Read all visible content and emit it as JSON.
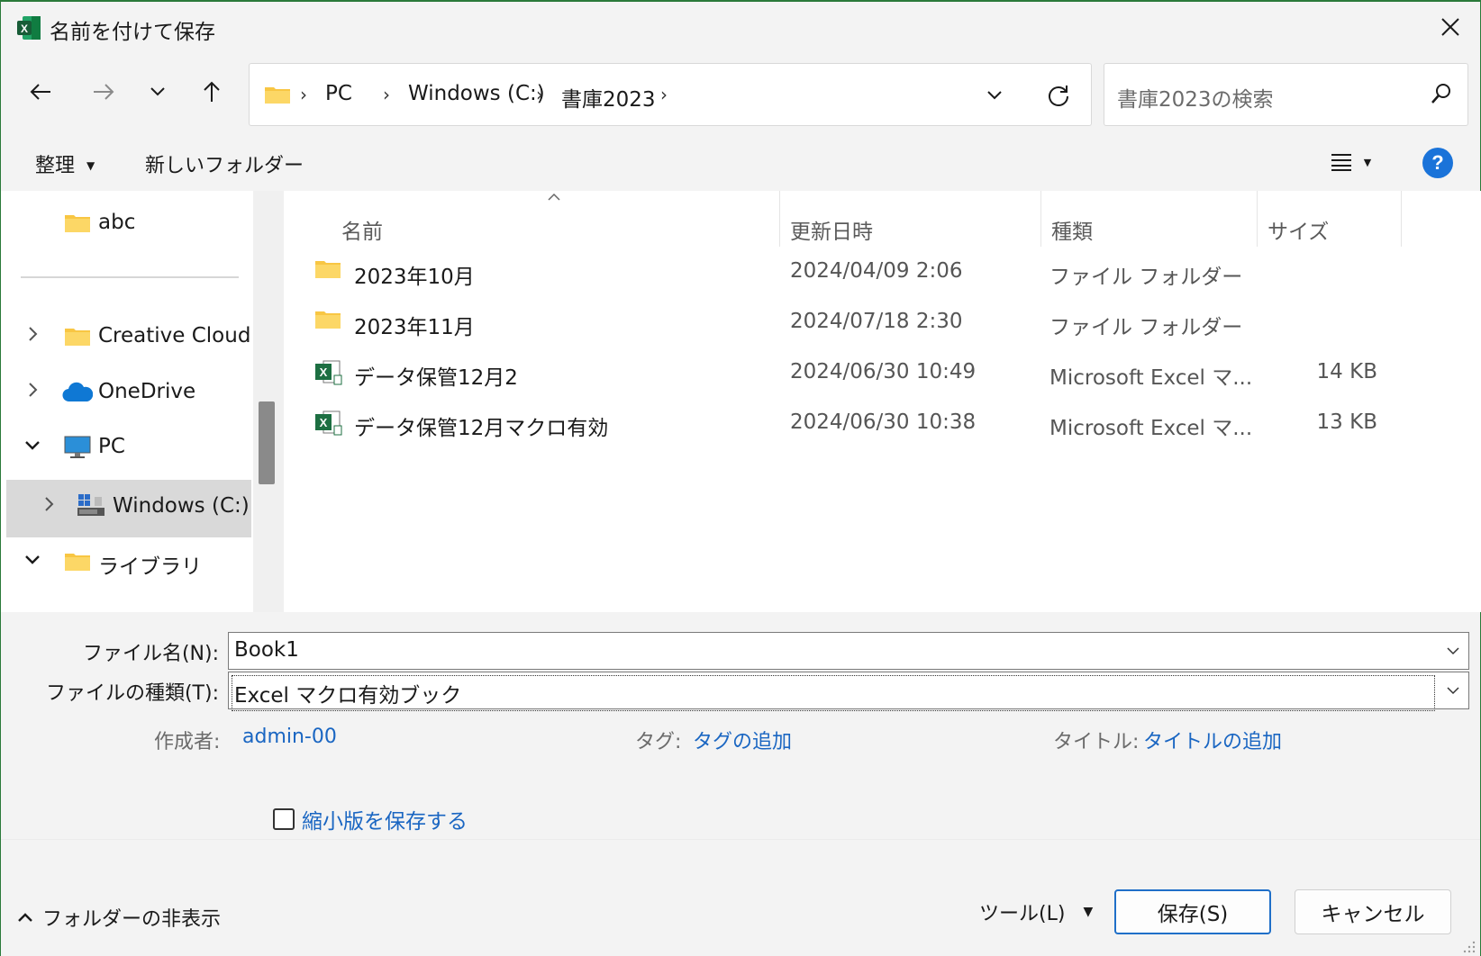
{
  "window": {
    "title": "名前を付けて保存",
    "app_icon": "excel-icon"
  },
  "nav": {
    "breadcrumbs": [
      "PC",
      "Windows (C:)",
      "書庫2023"
    ],
    "search_placeholder": "書庫2023の検索"
  },
  "toolbar": {
    "organize": "整理",
    "new_folder": "新しいフォルダー"
  },
  "sidebar": {
    "items": [
      {
        "label": "abc",
        "icon": "folder-icon"
      },
      {
        "label": "Creative Cloud F",
        "icon": "folder-icon"
      },
      {
        "label": "OneDrive",
        "icon": "cloud-icon"
      },
      {
        "label": "PC",
        "icon": "monitor-icon"
      },
      {
        "label": "Windows (C:)",
        "icon": "drive-icon"
      },
      {
        "label": "ライブラリ",
        "icon": "folder-icon"
      }
    ]
  },
  "columns": {
    "name": "名前",
    "modified": "更新日時",
    "type": "種類",
    "size": "サイズ"
  },
  "files": [
    {
      "name": "2023年10月",
      "modified": "2024/04/09 2:06",
      "type": "ファイル フォルダー",
      "size": "",
      "icon": "folder-icon"
    },
    {
      "name": "2023年11月",
      "modified": "2024/07/18 2:30",
      "type": "ファイル フォルダー",
      "size": "",
      "icon": "folder-icon"
    },
    {
      "name": "データ保管12月2",
      "modified": "2024/06/30 10:49",
      "type": "Microsoft Excel マ...",
      "size": "14 KB",
      "icon": "excel-file-icon"
    },
    {
      "name": "データ保管12月マクロ有効",
      "modified": "2024/06/30 10:38",
      "type": "Microsoft Excel マ...",
      "size": "13 KB",
      "icon": "excel-file-icon"
    }
  ],
  "save": {
    "filename_label": "ファイル名(N):",
    "filename_value": "Book1",
    "filetype_label": "ファイルの種類(T):",
    "filetype_value": "Excel マクロ有効ブック",
    "author_label": "作成者:",
    "author_value": "admin-00",
    "tags_label": "タグ:",
    "tags_value": "タグの追加",
    "title_label": "タイトル:",
    "title_value": "タイトルの追加",
    "thumbnail_label": "縮小版を保存する"
  },
  "footer": {
    "hide_folders": "フォルダーの非表示",
    "tools": "ツール(L)",
    "save": "保存(S)",
    "cancel": "キャンセル"
  },
  "colors": {
    "accent": "#1a66c2",
    "excel_green": "#1d6f42",
    "folder_yellow": "#f8c643"
  }
}
